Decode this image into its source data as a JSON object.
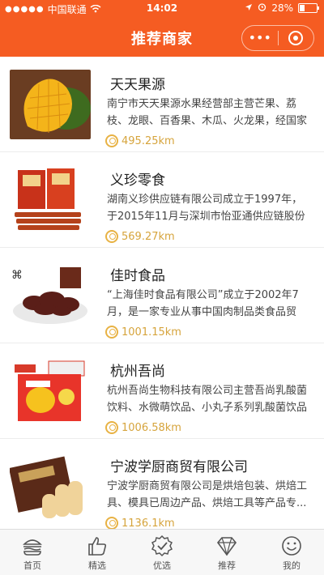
{
  "status_bar": {
    "carrier": "中国联通",
    "time": "14:02",
    "battery": "28%"
  },
  "nav": {
    "title": "推荐商家",
    "more_label": "•••"
  },
  "merchants": [
    {
      "name": "天天果源",
      "description": "南宁市天天果源水果经营部主营芒果、荔枝、龙眼、百香果、木瓜、火龙果，经国家工商...",
      "distance": "495.25km",
      "image": "mango"
    },
    {
      "name": "义珍零食",
      "description": "湖南义珍供应链有限公司成立于1997年，于2015年11月与深圳市怡亚通供应链股份有限...",
      "distance": "569.27km",
      "image": "spicy-snack"
    },
    {
      "name": "佳时食品",
      "description": "“上海佳时食品有限公司”成立于2002年7月，是一家专业从事中国肉制品类食品贸易、...",
      "distance": "1001.15km",
      "image": "jerky"
    },
    {
      "name": "杭州吾尚",
      "description": "杭州吾尚生物科技有限公司主营吾尚乳酸菌饮料、水微萌饮品、小丸子系列乳酸菌饮品等。",
      "distance": "1006.58km",
      "image": "drink-box"
    },
    {
      "name": "宁波学厨商贸有限公司",
      "description": "宁波学厨商贸有限公司是烘焙包装、烘焙工具、模具已周边产品、烘焙工具等产品专...",
      "distance": "1136.1km",
      "image": "cookies"
    }
  ],
  "tabbar": [
    {
      "label": "首页",
      "icon": "burger-icon"
    },
    {
      "label": "精选",
      "icon": "thumbs-up-icon"
    },
    {
      "label": "优选",
      "icon": "badge-check-icon"
    },
    {
      "label": "推荐",
      "icon": "diamond-icon"
    },
    {
      "label": "我的",
      "icon": "smiley-icon"
    }
  ],
  "colors": {
    "brand": "#f55c22",
    "distance": "#d6a43c"
  }
}
